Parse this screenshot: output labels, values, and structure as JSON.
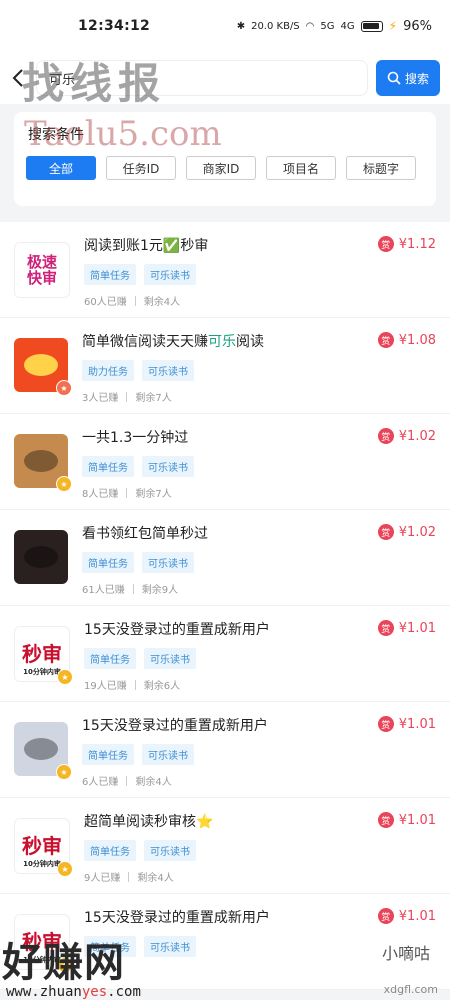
{
  "status": {
    "time": "12:34:12",
    "net_speed": "20.0 KB/S",
    "signal": "5G",
    "signal2": "4G",
    "battery": "96%"
  },
  "search": {
    "value": "可乐",
    "button_label": "搜索"
  },
  "watermarks": {
    "top": "找线报",
    "mid": "Taolu5.com",
    "bottom": "好赚网",
    "bottom_url_a": "www.zhuan",
    "bottom_url_b": "yes",
    "bottom_url_c": ".com",
    "bottom_right": "小嘀咕",
    "bottom_right_url": "xdgfl.com"
  },
  "filter": {
    "title": "搜索条件",
    "chips": [
      "全部",
      "任务ID",
      "商家ID",
      "项目名",
      "标题字"
    ]
  },
  "items": [
    {
      "title": "阅读到账1元✅秒审",
      "tags": [
        "简单任务",
        "可乐读书"
      ],
      "earned": "60人已赚",
      "remaining": "剩余4人",
      "price": "¥1.12",
      "thumb_text": "极速\n快审",
      "thumb_bg": "#ffffff",
      "thumb_color": "#d0207a",
      "badge": ""
    },
    {
      "title_a": "简单微信阅读天天赚",
      "title_b": "可乐",
      "title_c": "阅读",
      "tags": [
        "助力任务",
        "可乐读书"
      ],
      "earned": "3人已赚",
      "remaining": "剩余7人",
      "price": "¥1.08",
      "thumb_text": "",
      "thumb_bg": "#f04a20",
      "thumb_color": "#ffd24a",
      "badge": "red"
    },
    {
      "title": "一共1.3一分钟过",
      "tags": [
        "简单任务",
        "可乐读书"
      ],
      "earned": "8人已赚",
      "remaining": "剩余7人",
      "price": "¥1.02",
      "thumb_text": "",
      "thumb_bg": "#c58a4e",
      "thumb_color": "#000",
      "badge": "gold"
    },
    {
      "title": "看书领红包简单秒过",
      "tags": [
        "简单任务",
        "可乐读书"
      ],
      "earned": "61人已赚",
      "remaining": "剩余9人",
      "price": "¥1.02",
      "thumb_text": "",
      "thumb_bg": "#2a2020",
      "thumb_color": "#000",
      "badge": ""
    },
    {
      "title": "15天没登录过的重置成新用户",
      "tags": [
        "简单任务",
        "可乐读书"
      ],
      "earned": "19人已赚",
      "remaining": "剩余6人",
      "price": "¥1.01",
      "thumb_text": "秒审",
      "thumb_sub": "10分钟内审",
      "thumb_bg": "#ffffff",
      "thumb_color": "#c8102e",
      "badge": "gold"
    },
    {
      "title": "15天没登录过的重置成新用户",
      "tags": [
        "简单任务",
        "可乐读书"
      ],
      "earned": "6人已赚",
      "remaining": "剩余4人",
      "price": "¥1.01",
      "thumb_text": "",
      "thumb_bg": "#cfd6e2",
      "thumb_color": "#000",
      "badge": "gold"
    },
    {
      "title": "超简单阅读秒审核⭐",
      "tags": [
        "简单任务",
        "可乐读书"
      ],
      "earned": "9人已赚",
      "remaining": "剩余4人",
      "price": "¥1.01",
      "thumb_text": "秒审",
      "thumb_sub": "10分钟内审",
      "thumb_bg": "#ffffff",
      "thumb_color": "#c8102e",
      "badge": "gold"
    },
    {
      "title": "15天没登录过的重置成新用户",
      "tags": [
        "简单任务",
        "可乐读书"
      ],
      "earned": "",
      "remaining": "",
      "price": "¥1.01",
      "thumb_text": "秒审",
      "thumb_sub": "10分钟内审",
      "thumb_bg": "#ffffff",
      "thumb_color": "#c8102e",
      "badge": "gold"
    }
  ],
  "reward_icon": "赏"
}
